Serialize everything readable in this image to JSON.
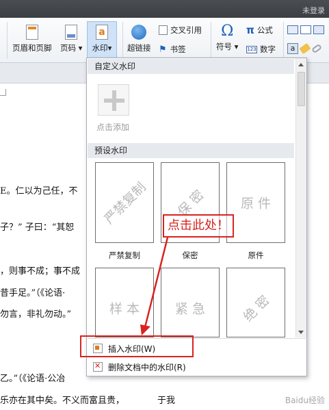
{
  "window": {
    "login_status": "未登录"
  },
  "ribbon": {
    "header_footer": "页眉和页脚",
    "page_number": "页码",
    "watermark": "水印",
    "hyperlink": "超链接",
    "cross_reference": "交叉引用",
    "bookmark": "书签",
    "symbol": "符号",
    "formula": "公式",
    "number": "数字",
    "dropdown_arrow": "▾"
  },
  "watermark_menu": {
    "custom_section": "自定义水印",
    "add_label": "点击添加",
    "preset_section": "预设水印",
    "presets": [
      {
        "text": "严禁复制",
        "label": "严禁复制",
        "rotated": true
      },
      {
        "text": "保 密",
        "label": "保密",
        "rotated": true
      },
      {
        "text": "原 件",
        "label": "原件",
        "rotated": false
      },
      {
        "text": "样 本",
        "label": "",
        "rotated": false
      },
      {
        "text": "紧 急",
        "label": "",
        "rotated": false
      },
      {
        "text": "绝 密",
        "label": "",
        "rotated": true
      }
    ],
    "insert_item": "插入水印(W)",
    "delete_item": "删除文档中的水印(R)"
  },
  "annotation": {
    "callout": "点击此处！"
  },
  "document_lines": [
    "E。仁以为己任，不",
    "子？” 子曰：“其恕",
    "，则事不成；事不成",
    "昔手足。”（《论语·",
    "勿言，非礼勿动。”",
    "乙。”（《论语·公冶",
    "乐亦在其中矣。不义而富且贵，",
    "于我"
  ],
  "footer_watermark": "Baidu经验"
}
